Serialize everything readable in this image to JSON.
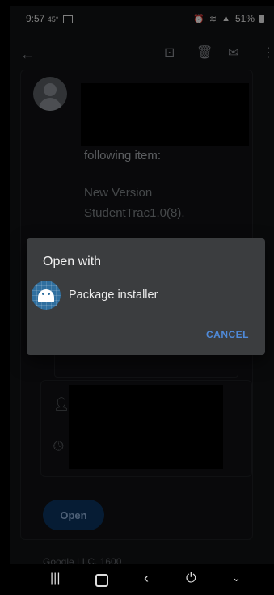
{
  "status_bar": {
    "time": "9:57",
    "secondary": "45°",
    "battery": "51%"
  },
  "app_bar": {
    "icons": [
      "back-arrow-icon",
      "archive-icon",
      "delete-icon",
      "mail-icon",
      "more-vert-icon"
    ]
  },
  "message": {
    "line1": "following item:",
    "line2": "New Version",
    "line3": "StudentTrac1.0(8)."
  },
  "dialog": {
    "title": "Open with",
    "option_label": "Package installer",
    "cancel_label": "CANCEL"
  },
  "action": {
    "open_label": "Open"
  },
  "footer": {
    "text": "Google LLC, 1600"
  },
  "colors": {
    "accent": "#4f8ad9",
    "dialog_bg": "#3b3d3f",
    "screen_bg": "#121314"
  }
}
